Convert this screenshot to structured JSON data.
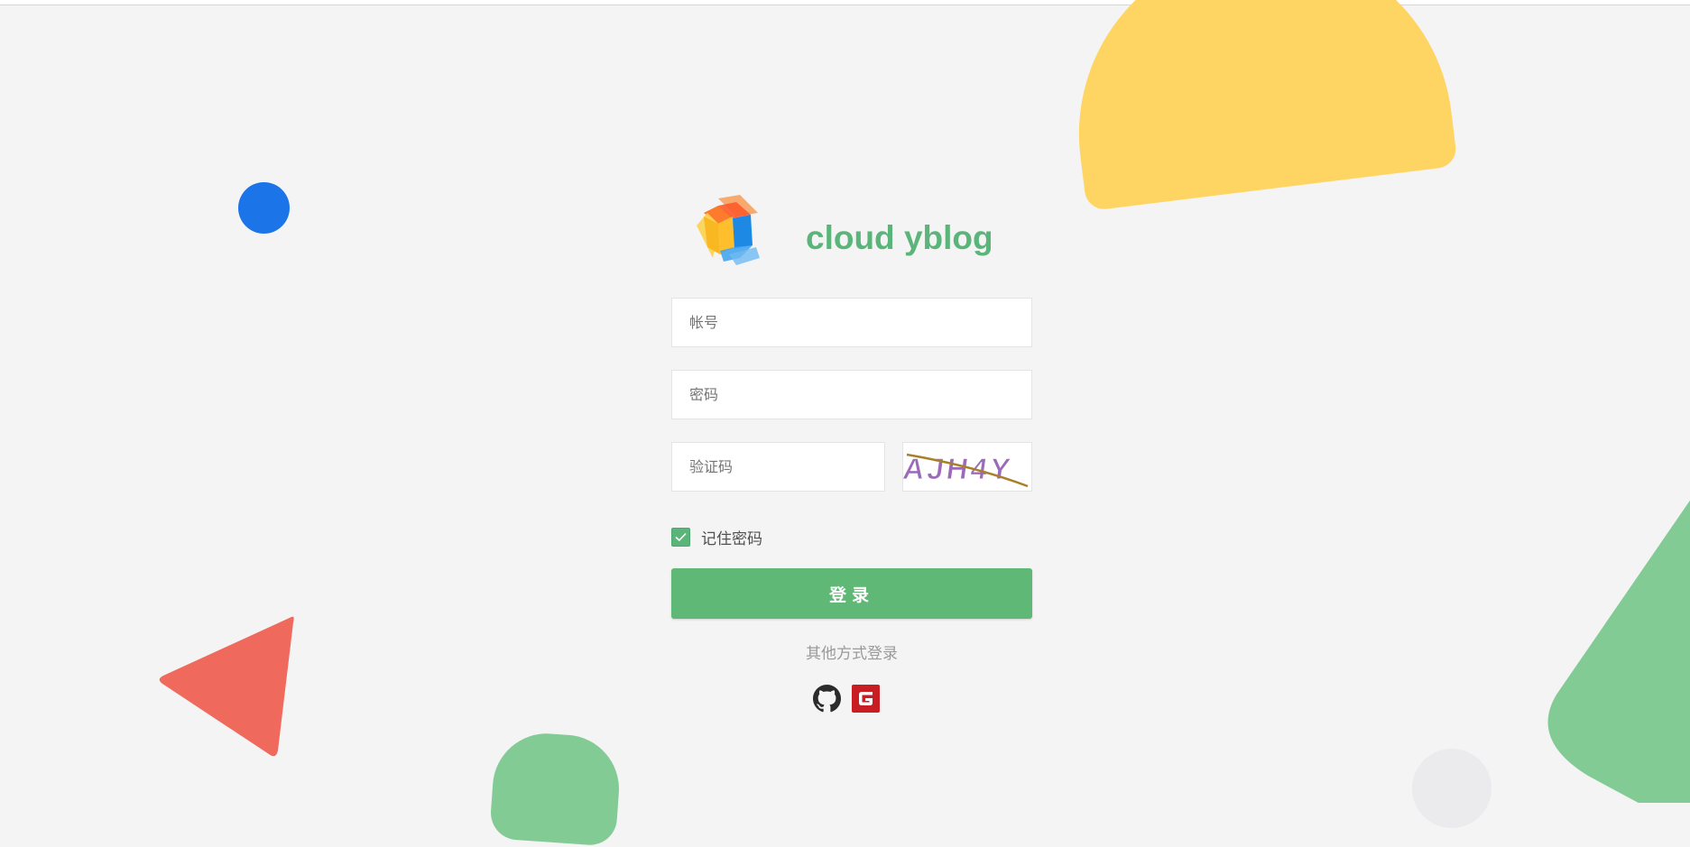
{
  "brand": {
    "title": "cloud yblog",
    "title_color": "#5bb57a"
  },
  "form": {
    "account_placeholder": "帐号",
    "password_placeholder": "密码",
    "captcha_placeholder": "验证码",
    "captcha_image_text": "AJH4Y",
    "remember_label": "记住密码",
    "remember_checked": true,
    "login_button_label": "登录",
    "other_login_label": "其他方式登录"
  },
  "social_logins": [
    {
      "name": "github",
      "icon": "github-icon"
    },
    {
      "name": "gitee",
      "icon": "gitee-icon"
    }
  ],
  "colors": {
    "background": "#f4f4f4",
    "accent_green": "#5fb876",
    "decor_yellow": "#fed563",
    "decor_blue": "#1c74e9",
    "decor_red": "#ef6a5c",
    "decor_green": "#83cb95",
    "gitee_red": "#c71d23"
  }
}
